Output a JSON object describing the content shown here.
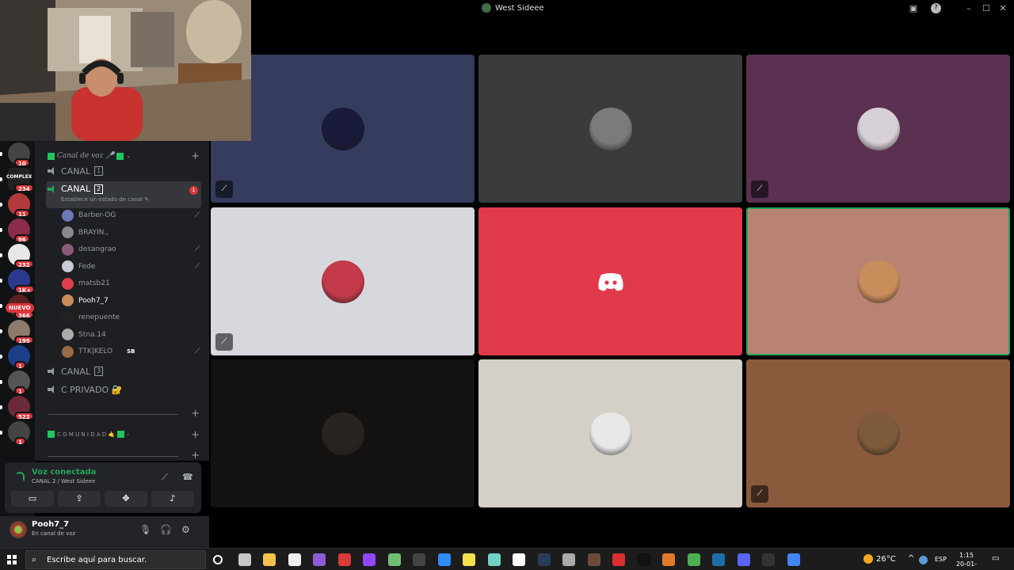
{
  "window": {
    "title": "West Sideee"
  },
  "servers": [
    {
      "badge": "10",
      "color": "#444"
    },
    {
      "badge": "234",
      "color": "#222",
      "label": "COMPLEX"
    },
    {
      "badge": "11",
      "color": "#b23a3a"
    },
    {
      "badge": "96",
      "color": "#8a2c4a"
    },
    {
      "badge": "232",
      "color": "#e8e8e8"
    },
    {
      "badge": "1K+",
      "color": "#2a3b8f"
    },
    {
      "badge": "366",
      "color": "#5a1f1f"
    },
    {
      "badge": "199",
      "color": "#8c7b6a"
    },
    {
      "badge": "1",
      "color": "#1d3f8a"
    },
    {
      "badge": "1",
      "color": "#555"
    },
    {
      "badge": "522",
      "color": "#6b2a3a"
    },
    {
      "badge": "1",
      "color": "#444"
    }
  ],
  "nuevo_label": "NUEVO",
  "category_voice": "Canal de voz 🎤",
  "channels": {
    "canal1": {
      "name": "CANAL",
      "num": "1"
    },
    "canal2": {
      "name": "CANAL",
      "num": "2",
      "status": "Establece un estado de canal",
      "mentions": "1"
    },
    "canal3": {
      "name": "CANAL",
      "num": "3"
    },
    "cprivado": {
      "name": "C PRIVADO 🔐"
    }
  },
  "members": [
    {
      "name": "Barber-OG",
      "muted": true,
      "color": "#6b7ab5"
    },
    {
      "name": "BRAYIN.,",
      "muted": false,
      "color": "#888"
    },
    {
      "name": "desangrao",
      "muted": true,
      "color": "#8a5a7a"
    },
    {
      "name": "Fede",
      "muted": true,
      "color": "#c7cbd6"
    },
    {
      "name": "matsb21",
      "muted": false,
      "color": "#e23e4f"
    },
    {
      "name": "Pooh7_7",
      "muted": false,
      "color": "#c98c5b"
    },
    {
      "name": "renepuente",
      "muted": false,
      "color": "#222"
    },
    {
      "name": "Stna.14",
      "muted": false,
      "color": "#aaa"
    },
    {
      "name": "TTK|KELO",
      "muted": true,
      "color": "#9a6a4a",
      "extra": "SB"
    }
  ],
  "category_community": "C O M U N I D A D 🤙",
  "voice_panel": {
    "connected": "Voz conectada",
    "location": "CANAL 2 / West Sideee"
  },
  "user_panel": {
    "username": "Pooh7_7",
    "status": "En canal de voz"
  },
  "tiles": [
    {
      "bg": "#363c5e",
      "avatar": "#1a1a3a",
      "muted": true,
      "speaking": false
    },
    {
      "bg": "#3a3b3c",
      "avatar": "#7b7b7b",
      "muted": false,
      "speaking": false
    },
    {
      "bg": "#5a3150",
      "avatar": "#d8d0d8",
      "muted": true,
      "speaking": false
    },
    {
      "bg": "#d6d8dd",
      "avatar": "#c43a4a",
      "muted": true,
      "speaking": false
    },
    {
      "bg": "#e03a4a",
      "avatar": "discord",
      "muted": false,
      "speaking": false
    },
    {
      "bg": "#b98373",
      "avatar": "#c98c5b",
      "muted": false,
      "speaking": true
    },
    {
      "bg": "#141210",
      "avatar": "#2a2420",
      "muted": false,
      "speaking": false
    },
    {
      "bg": "#d4d0c8",
      "avatar": "#e8e8e8",
      "muted": false,
      "speaking": false
    },
    {
      "bg": "#8a5a3c",
      "avatar": "#7d5a3a",
      "muted": true,
      "speaking": false
    }
  ],
  "taskbar": {
    "search_placeholder": "Escribe aquí para buscar.",
    "temperature": "26°C",
    "language": "ESP",
    "time": "1:15",
    "date": "20-01-2026"
  },
  "icons": {
    "mute": "🎙",
    "deafen": "🎧",
    "settings": "⚙",
    "speaker": "speaker-icon"
  }
}
